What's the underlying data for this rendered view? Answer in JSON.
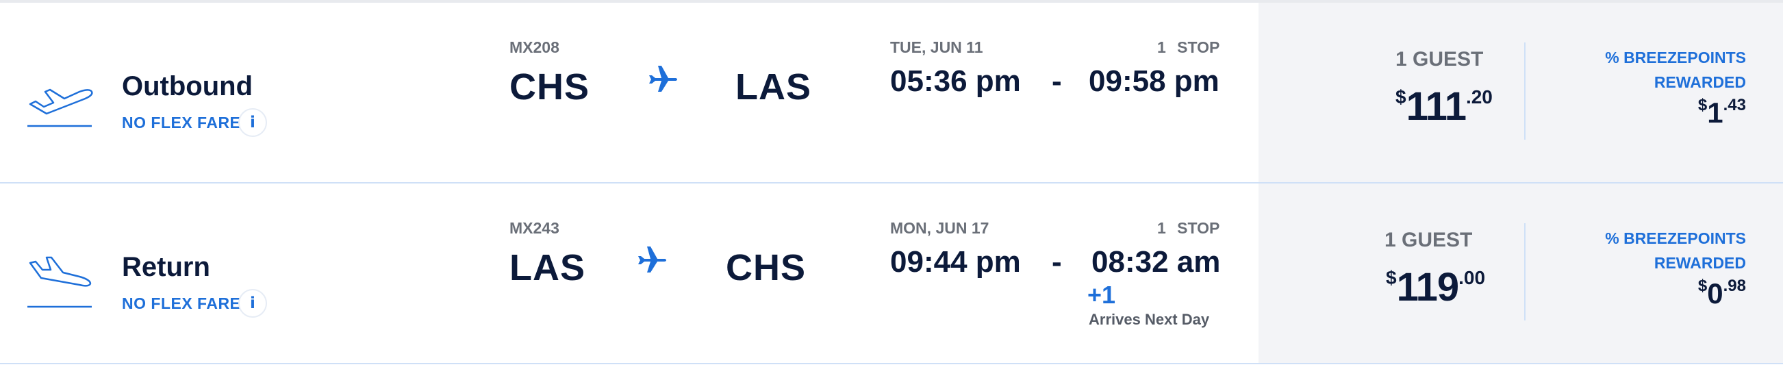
{
  "flights": [
    {
      "direction": "Outbound",
      "fare_type": "NO FLEX FARE",
      "info_icon": "i",
      "flight_number": "MX208",
      "origin": "CHS",
      "destination": "LAS",
      "date": "TUE, JUN 11",
      "stops": "1  STOP",
      "depart_time": "05:36 pm",
      "separator": "-",
      "arrive_time": "09:58 pm",
      "guests": "1 GUEST",
      "price": {
        "currency": "$",
        "whole": "111",
        "cents": ".20"
      },
      "points_label_line1": "% BREEZEPOINTS",
      "points_label_line2": "REWARDED",
      "points": {
        "currency": "$",
        "whole": "1",
        "cents": ".43"
      },
      "icon": "plane-takeoff-icon"
    },
    {
      "direction": "Return",
      "fare_type": "NO FLEX FARE",
      "info_icon": "i",
      "flight_number": "MX243",
      "origin": "LAS",
      "destination": "CHS",
      "date": "MON, JUN 17",
      "stops": "1  STOP",
      "depart_time": "09:44 pm",
      "separator": "-",
      "arrive_time": "08:32 am",
      "day_offset": "+1",
      "arrives_note": "Arrives Next Day",
      "guests": "1 GUEST",
      "price": {
        "currency": "$",
        "whole": "119",
        "cents": ".00"
      },
      "points_label_line1": "% BREEZEPOINTS",
      "points_label_line2": "REWARDED",
      "points": {
        "currency": "$",
        "whole": "0",
        "cents": ".98"
      },
      "icon": "plane-landing-icon"
    }
  ],
  "colors": {
    "navy": "#0c1a3a",
    "accent_blue": "#1e6fd9",
    "muted_gray": "#6a6f78",
    "panel_bg": "#f3f4f7"
  }
}
